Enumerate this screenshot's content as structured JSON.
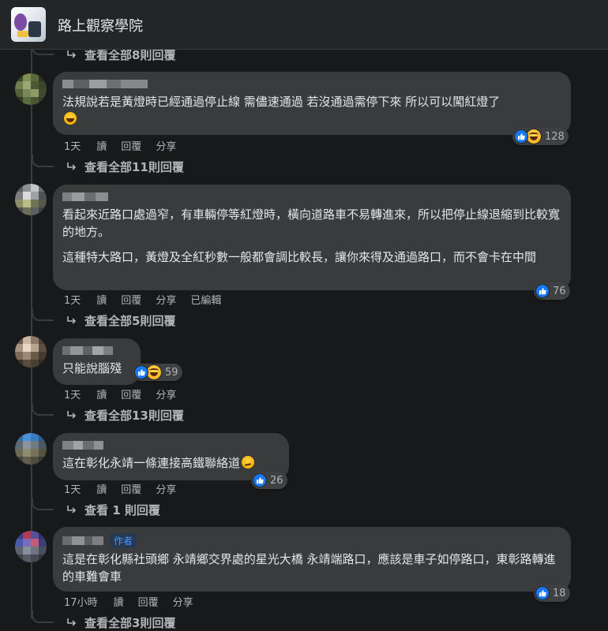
{
  "page": {
    "name": "路上觀察學院"
  },
  "top_replies_link": "查看全部8則回覆",
  "comments": [
    {
      "paragraphs": [
        "法規說若是黃燈時已經通過停止線 需儘速通過 若沒通過需停下來 所以可以闖紅燈了"
      ],
      "trailing_emoji": "laughing-emoji",
      "time": "1天",
      "read": "讀",
      "reply": "回覆",
      "share": "分享",
      "edited": "",
      "reactions": [
        "like",
        "haha"
      ],
      "reaction_count": "128",
      "replies_link": "查看全部11則回覆"
    },
    {
      "paragraphs": [
        "看起來近路口處過窄，有車輛停等紅燈時，橫向道路車不易轉進來，所以把停止線退縮到比較寬的地方。",
        "這種特大路口，黃燈及全紅秒數一般都會調比較長，讓你來得及通過路口，而不會卡在中間"
      ],
      "trailing_emoji": "",
      "time": "1天",
      "read": "讀",
      "reply": "回覆",
      "share": "分享",
      "edited": "已編輯",
      "reactions": [
        "like"
      ],
      "reaction_count": "76",
      "replies_link": "查看全部5則回覆"
    },
    {
      "paragraphs": [
        "只能說腦殘"
      ],
      "trailing_emoji": "",
      "time": "1天",
      "read": "讀",
      "reply": "回覆",
      "share": "分享",
      "edited": "",
      "reactions": [
        "like",
        "haha"
      ],
      "reaction_count": "59",
      "replies_link": "查看全部13則回覆"
    },
    {
      "paragraphs": [
        "這在彰化永靖一條連接高鐵聯絡道"
      ],
      "trailing_emoji": "smirk-emoji",
      "time": "1天",
      "read": "讀",
      "reply": "回覆",
      "share": "分享",
      "edited": "",
      "reactions": [
        "like"
      ],
      "reaction_count": "26",
      "replies_link": "查看 1 則回覆"
    },
    {
      "author_badge": "作者",
      "paragraphs": [
        "這是在彰化縣社頭鄉 永靖鄉交界處的星光大橋 永靖端路口，應該是車子如停路口，東彰路轉進的車難會車"
      ],
      "trailing_emoji": "",
      "time": "17小時",
      "read": "讀",
      "reply": "回覆",
      "share": "分享",
      "edited": "",
      "reactions": [
        "like"
      ],
      "reaction_count": "18",
      "replies_link": "查看全部3則回覆"
    }
  ],
  "colors": {
    "background": "#18191a",
    "bubble": "#3a3b3c",
    "like_blue": "#1877f2",
    "author_badge": "#4599ff"
  }
}
